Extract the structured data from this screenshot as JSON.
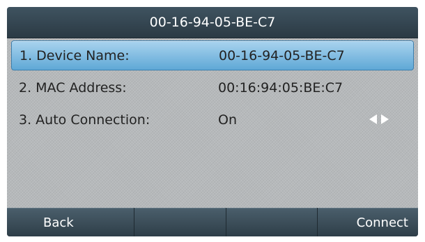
{
  "title": "00-16-94-05-BE-C7",
  "rows": [
    {
      "label": "1. Device Name:",
      "value": "00-16-94-05-BE-C7"
    },
    {
      "label": "2. MAC Address:",
      "value": "00:16:94:05:BE:C7"
    },
    {
      "label": "3. Auto Connection:",
      "value": "On"
    }
  ],
  "softkeys": [
    "Back",
    "",
    "",
    "Connect"
  ],
  "colors": {
    "title_bar": "#34464f",
    "selected_row": "#7fbce3",
    "softkey": "#3b4f5c"
  }
}
